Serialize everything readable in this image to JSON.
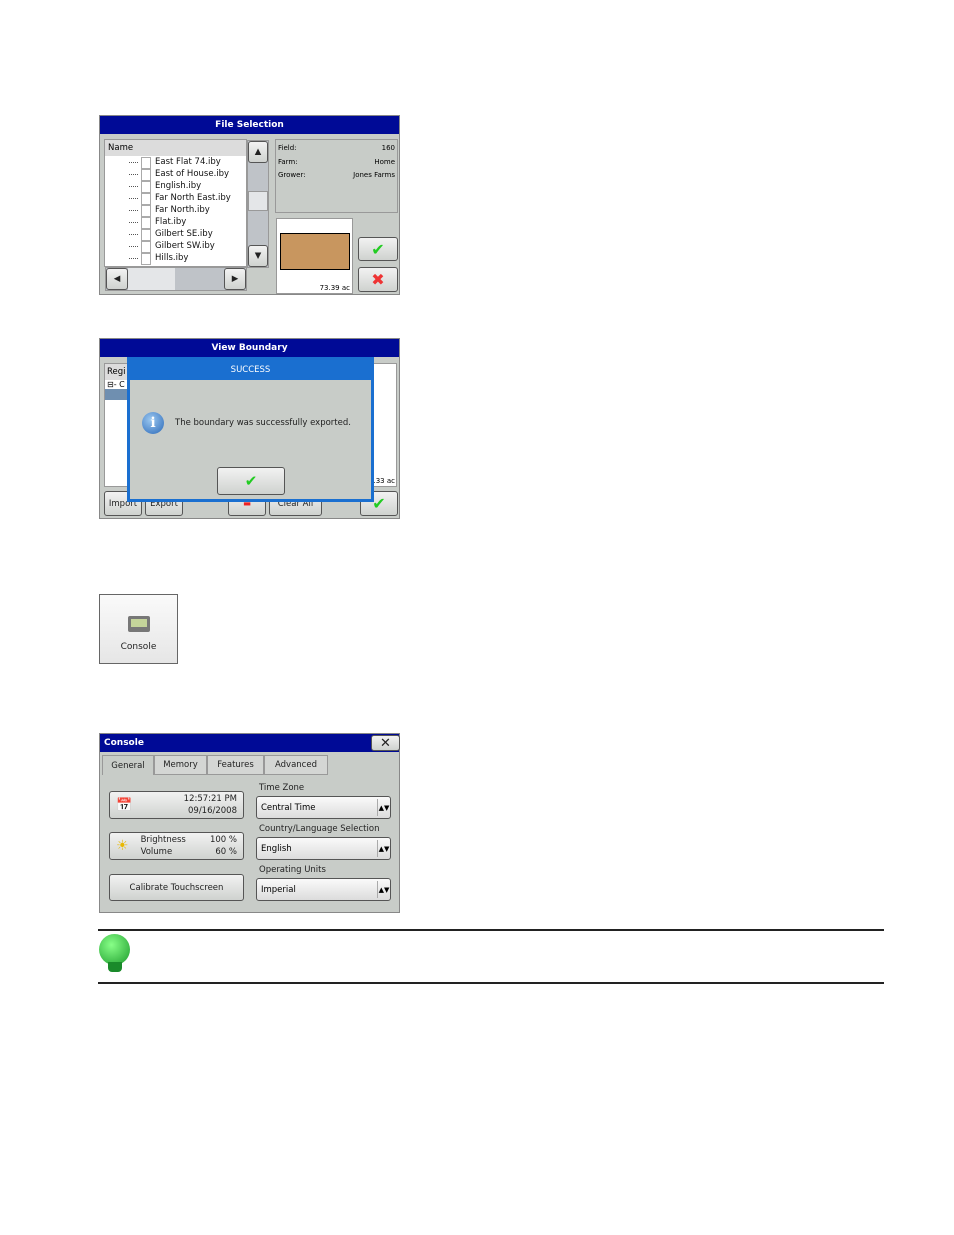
{
  "file_selection": {
    "title": "File Selection",
    "column": "Name",
    "files": [
      "East Flat 74.iby",
      "East of House.iby",
      "English.iby",
      "Far North East.iby",
      "Far North.iby",
      "Flat.iby",
      "Gilbert SE.iby",
      "Gilbert SW.iby",
      "Hills.iby"
    ],
    "info": [
      {
        "label": "Field:",
        "value": "160"
      },
      {
        "label": "Farm:",
        "value": "Home"
      },
      {
        "label": "Grower:",
        "value": "Jones Farms"
      }
    ],
    "area": "73.39 ac",
    "boundary_color": "#c8965f"
  },
  "view_boundary": {
    "title": "View Boundary",
    "list_header": "Regi",
    "tree_item": "⊟- C",
    "area": ".33 ac",
    "buttons": {
      "import": "Import",
      "export": "Export",
      "clear_all": "Clear All"
    },
    "dialog": {
      "title": "SUCCESS",
      "message": "The boundary was successfully exported."
    }
  },
  "console_tile": {
    "label": "Console"
  },
  "console": {
    "title": "Console",
    "tabs": [
      "General",
      "Memory",
      "Features",
      "Advanced"
    ],
    "active_tab": "General",
    "time": "12:57:21 PM",
    "date": "09/16/2008",
    "brightness_label": "Brightness",
    "brightness": "100 %",
    "volume_label": "Volume",
    "volume": "60 %",
    "calibrate": "Calibrate Touchscreen",
    "time_zone_label": "Time Zone",
    "time_zone": "Central Time",
    "language_label": "Country/Language Selection",
    "language": "English",
    "units_label": "Operating Units",
    "units": "Imperial"
  }
}
